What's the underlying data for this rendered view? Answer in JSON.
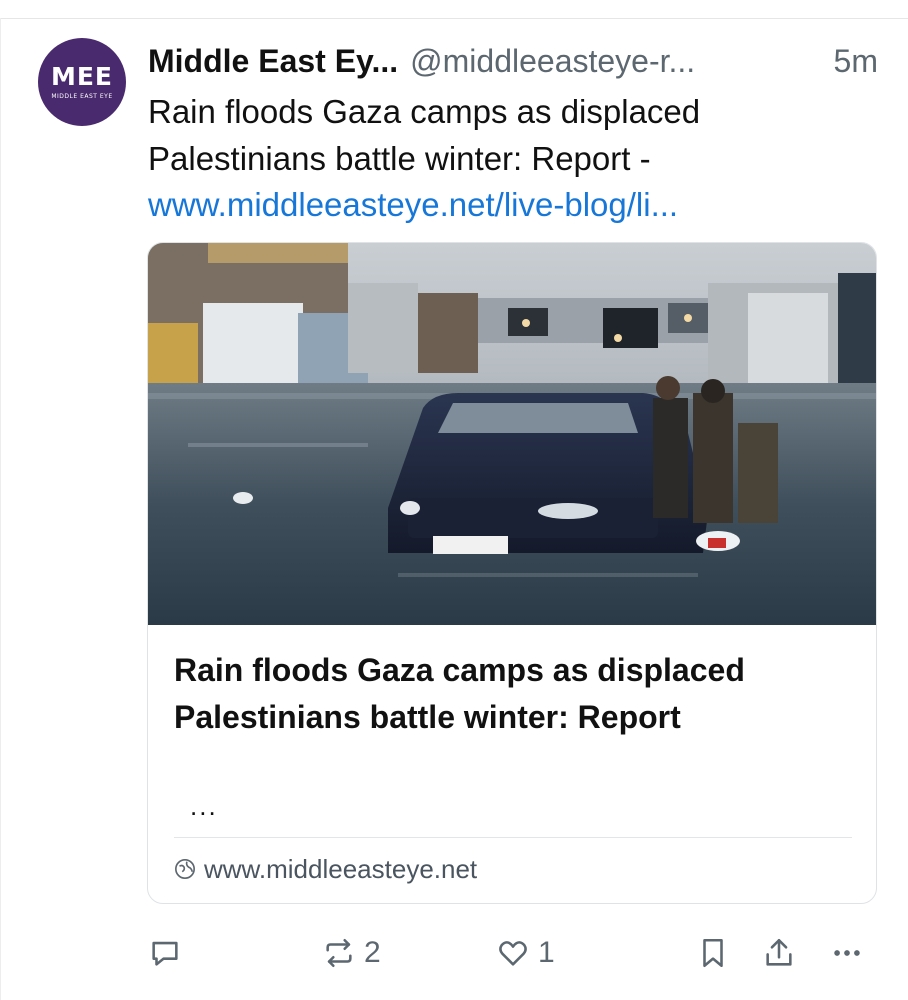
{
  "post": {
    "author": {
      "display_name": "Middle East Ey...",
      "handle": "@middleeasteye-r...",
      "avatar_mark": "MEE",
      "avatar_subtitle": "MIDDLE EAST EYE"
    },
    "timestamp": "5m",
    "text": "Rain floods Gaza camps as displaced Palestinians battle winter: Report -",
    "link_text": "www.middleeasteye.net/live-blog/li..."
  },
  "link_card": {
    "image_icon": "flooded-street-photo",
    "title": "Rain floods Gaza camps as displaced Palestinians battle winter: Report",
    "description": "...",
    "domain": "www.middleeasteye.net",
    "domain_icon": "globe-icon"
  },
  "actions": {
    "reply_icon": "reply-icon",
    "repost_icon": "repost-icon",
    "repost_count": "2",
    "like_icon": "heart-icon",
    "like_count": "1",
    "bookmark_icon": "bookmark-icon",
    "share_icon": "share-icon",
    "more_icon": "more-icon"
  },
  "colors": {
    "link": "#1677d8",
    "muted": "#5c6770",
    "avatar_bg": "#4a2a6e"
  }
}
